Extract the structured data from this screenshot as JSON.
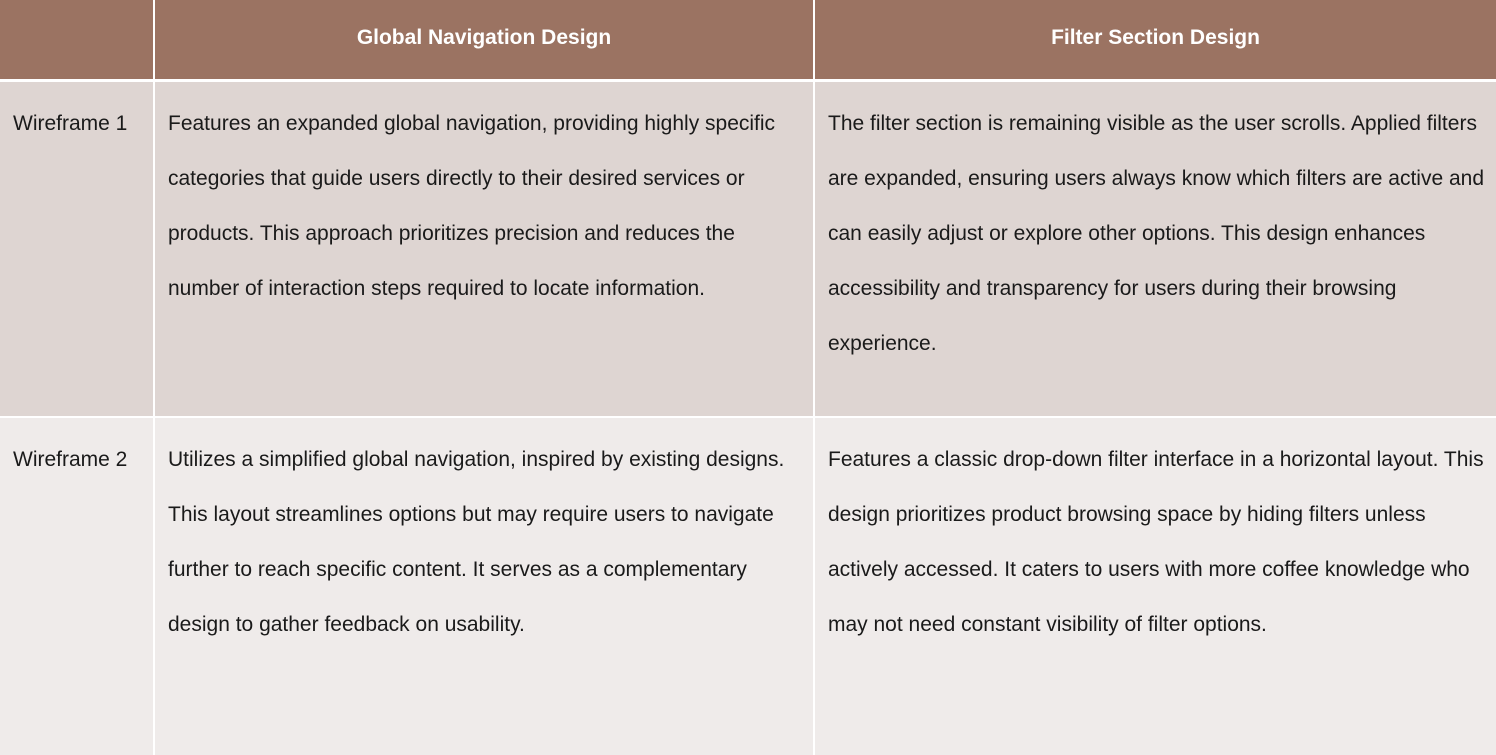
{
  "table": {
    "headers": [
      "",
      "Global Navigation Design",
      "Filter Section Design"
    ],
    "rows": [
      {
        "label": "Wireframe 1",
        "global_navigation": "Features an expanded global navigation, providing highly specific categories that guide users directly to their desired services or products. This approach prioritizes precision and reduces the number of interaction steps required to locate information.",
        "filter_section": "The filter section is remaining visible as the user scrolls. Applied filters are expanded, ensuring users always know which filters are active and can easily adjust or explore other options. This design enhances accessibility and transparency for users during their browsing experience."
      },
      {
        "label": "Wireframe 2",
        "global_navigation": "Utilizes a simplified global navigation, inspired by existing designs. This layout streamlines options but may require users to navigate further to reach specific content. It serves as a complementary design to gather feedback on usability.",
        "filter_section": "Features a classic drop-down filter interface in a horizontal layout. This design prioritizes product browsing space by hiding filters unless actively accessed. It caters to users with more coffee knowledge who may not need constant visibility of filter options."
      }
    ]
  },
  "colors": {
    "header_bg": "#9b7362",
    "row1_bg": "#ded5d2",
    "row2_bg": "#efebea",
    "header_text": "#ffffff",
    "body_text": "#1a1a1a"
  }
}
